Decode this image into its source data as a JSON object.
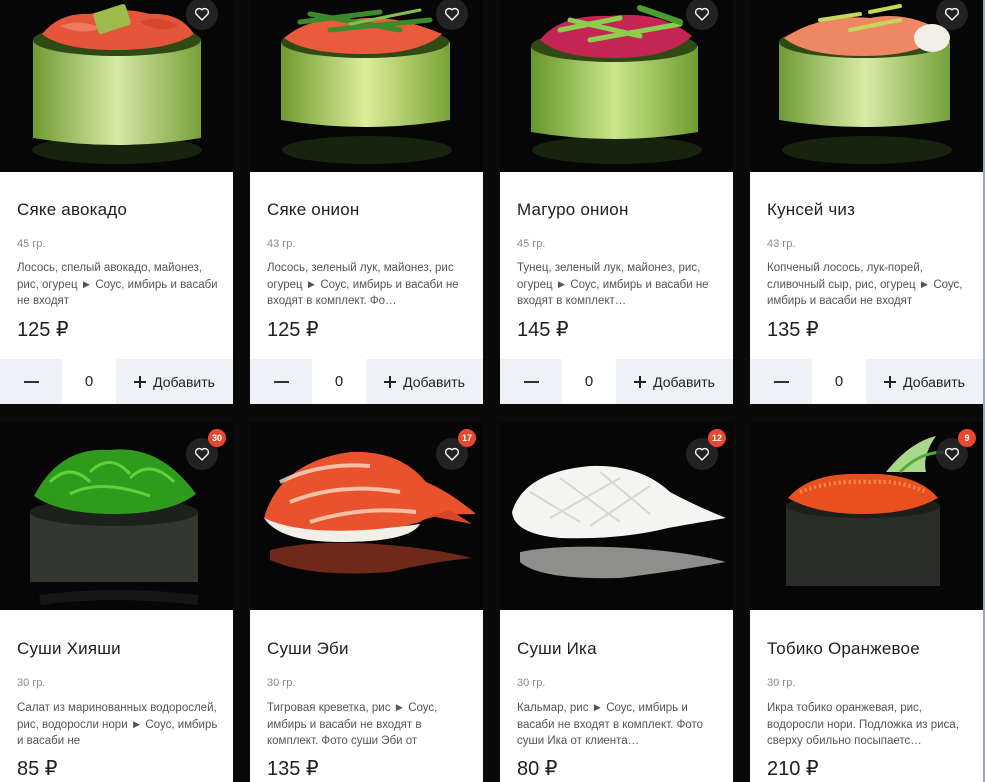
{
  "ui": {
    "add_label": "Добавить",
    "colors": {
      "accent_badge": "#e8482f",
      "control_bg": "#eef1f5"
    }
  },
  "products": [
    {
      "title": "Сяке авокадо",
      "weight": "45 гр.",
      "description": "Лосось, спелый авокадо, майонез, рис, огурец ► Соус, имбирь и васаби не входят",
      "price": "125 ₽",
      "quantity": "0",
      "topping": "salmon-avocado",
      "icon": "heart-icon"
    },
    {
      "title": "Сяке онион",
      "weight": "43 гр.",
      "description": "Лосось, зеленый лук, майонез, рис огурец ► Соус, имбирь и васаби не входят в комплект. Фо…",
      "price": "125 ₽",
      "quantity": "0",
      "topping": "salmon-onion",
      "icon": "heart-icon"
    },
    {
      "title": "Магуро онион",
      "weight": "45 гр.",
      "description": "Тунец, зеленый лук, майонез, рис, огурец ► Соус, имбирь и васаби не входят в комплект…",
      "price": "145 ₽",
      "quantity": "0",
      "topping": "tuna-onion",
      "icon": "heart-icon"
    },
    {
      "title": "Кунсей чиз",
      "weight": "43 гр.",
      "description": "Копченый лосось, лук-порей, сливочный сыр, рис, огурец ► Соус, имбирь и васаби не входят",
      "price": "135 ₽",
      "quantity": "0",
      "topping": "smoked-salmon-cheese",
      "icon": "heart-icon"
    },
    {
      "title": "Суши Хияши",
      "weight": "30 гр.",
      "description": "Салат из маринованных водорослей, рис, водоросли нори ► Соус, имбирь и васаби не",
      "price": "85 ₽",
      "badge": "30",
      "topping": "seaweed-gunkan",
      "icon": "heart-icon"
    },
    {
      "title": "Суши Эби",
      "weight": "30 гр.",
      "description": "Тигровая креветка, рис ► Соус, имбирь и васаби не входят в комплект. Фото суши Эби от",
      "price": "135 ₽",
      "badge": "17",
      "topping": "shrimp-nigiri",
      "icon": "heart-icon"
    },
    {
      "title": "Суши Ика",
      "weight": "30 гр.",
      "description": "Кальмар, рис ► Соус, имбирь и васаби не входят в комплект. Фото суши Ика от клиента…",
      "price": "80 ₽",
      "badge": "12",
      "topping": "squid-nigiri",
      "icon": "heart-icon"
    },
    {
      "title": "Тобико Оранжевое",
      "weight": "30 гр.",
      "description": "Икра тобико оранжевая, рис, водоросли нори.  Подложка из риса, сверху обильно посыпаетс…",
      "price": "210 ₽",
      "badge": "9",
      "topping": "tobiko-gunkan",
      "icon": "heart-icon"
    }
  ]
}
